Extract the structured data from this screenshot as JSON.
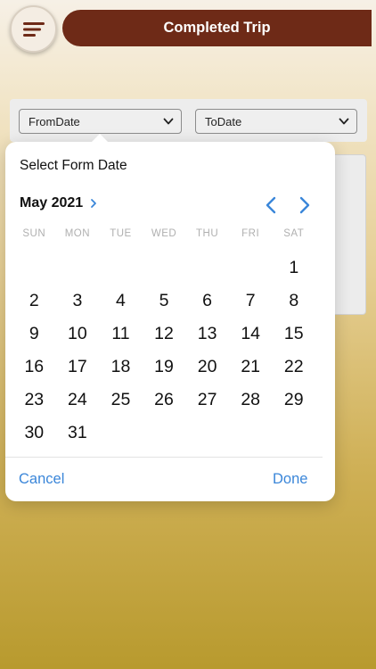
{
  "header": {
    "title": "Completed Trip"
  },
  "filters": {
    "from_value": "FromDate",
    "to_value": "ToDate"
  },
  "date_picker": {
    "title": "Select Form Date",
    "month_label": "May 2021",
    "weekdays": [
      "SUN",
      "MON",
      "TUE",
      "WED",
      "THU",
      "FRI",
      "SAT"
    ],
    "weeks": [
      [
        "",
        "",
        "",
        "",
        "",
        "",
        "1"
      ],
      [
        "2",
        "3",
        "4",
        "5",
        "6",
        "7",
        "8"
      ],
      [
        "9",
        "10",
        "11",
        "12",
        "13",
        "14",
        "15"
      ],
      [
        "16",
        "17",
        "18",
        "19",
        "20",
        "21",
        "22"
      ],
      [
        "23",
        "24",
        "25",
        "26",
        "27",
        "28",
        "29"
      ],
      [
        "30",
        "31",
        "",
        "",
        "",
        "",
        ""
      ]
    ],
    "cancel_label": "Cancel",
    "done_label": "Done"
  },
  "colors": {
    "title_bar": "#6e2a17",
    "accent": "#3a86d9"
  },
  "icons": {
    "menu": "hamburger-menu-icon",
    "prev": "chevron-left-icon",
    "next": "chevron-right-icon",
    "dropdown": "chevron-down-icon"
  }
}
